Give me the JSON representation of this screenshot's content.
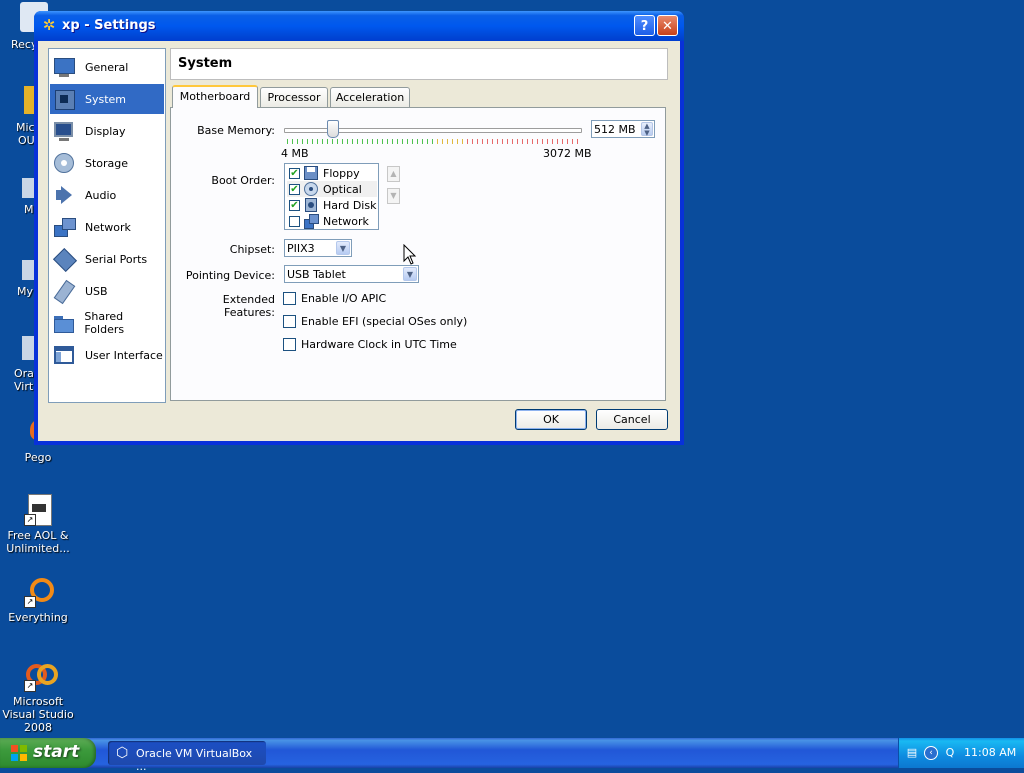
{
  "desktop": {
    "partial_labels": [
      "Recy",
      "Mic",
      "OU",
      "M",
      "My",
      "Ora",
      "Virt"
    ],
    "icons": [
      {
        "label": "Pego"
      },
      {
        "label": "Free AOL & Unlimited..."
      },
      {
        "label": "Everything"
      },
      {
        "label": "Microsoft Visual Studio 2008"
      }
    ]
  },
  "window": {
    "title": "xp - Settings",
    "help_glyph": "?",
    "close_glyph": "✕"
  },
  "nav": {
    "items": [
      {
        "label": "General",
        "icon": "monitor-icon"
      },
      {
        "label": "System",
        "icon": "chip-icon"
      },
      {
        "label": "Display",
        "icon": "display-icon"
      },
      {
        "label": "Storage",
        "icon": "disk-icon"
      },
      {
        "label": "Audio",
        "icon": "speaker-icon"
      },
      {
        "label": "Network",
        "icon": "network-icon"
      },
      {
        "label": "Serial Ports",
        "icon": "serial-icon"
      },
      {
        "label": "USB",
        "icon": "usb-icon"
      },
      {
        "label": "Shared Folders",
        "icon": "folder-icon"
      },
      {
        "label": "User Interface",
        "icon": "window-icon"
      }
    ],
    "selected": "System"
  },
  "section": {
    "title": "System"
  },
  "tabs": [
    {
      "label": "Motherboard"
    },
    {
      "label": "Processor"
    },
    {
      "label": "Acceleration"
    }
  ],
  "motherboard": {
    "base_memory_label": "Base Memory:",
    "memory_min": "4 MB",
    "memory_max": "3072 MB",
    "memory_value": "512 MB",
    "memory_fraction": 0.166,
    "boot_order_label": "Boot Order:",
    "boot_items": [
      {
        "label": "Floppy",
        "checked": true
      },
      {
        "label": "Optical",
        "checked": true
      },
      {
        "label": "Hard Disk",
        "checked": true
      },
      {
        "label": "Network",
        "checked": false
      }
    ],
    "chipset_label": "Chipset:",
    "chipset_value": "PIIX3",
    "pointing_label": "Pointing Device:",
    "pointing_value": "USB Tablet",
    "extended_label": "Extended Features:",
    "features": [
      {
        "label": "Enable I/O APIC",
        "checked": false
      },
      {
        "label": "Enable EFI (special OSes only)",
        "checked": false
      },
      {
        "label": "Hardware Clock in UTC Time",
        "checked": false
      }
    ]
  },
  "buttons": {
    "ok": "OK",
    "cancel": "Cancel"
  },
  "taskbar": {
    "start_label": "start",
    "task_label": "Oracle VM VirtualBox ...",
    "clock": "11:08 AM"
  }
}
